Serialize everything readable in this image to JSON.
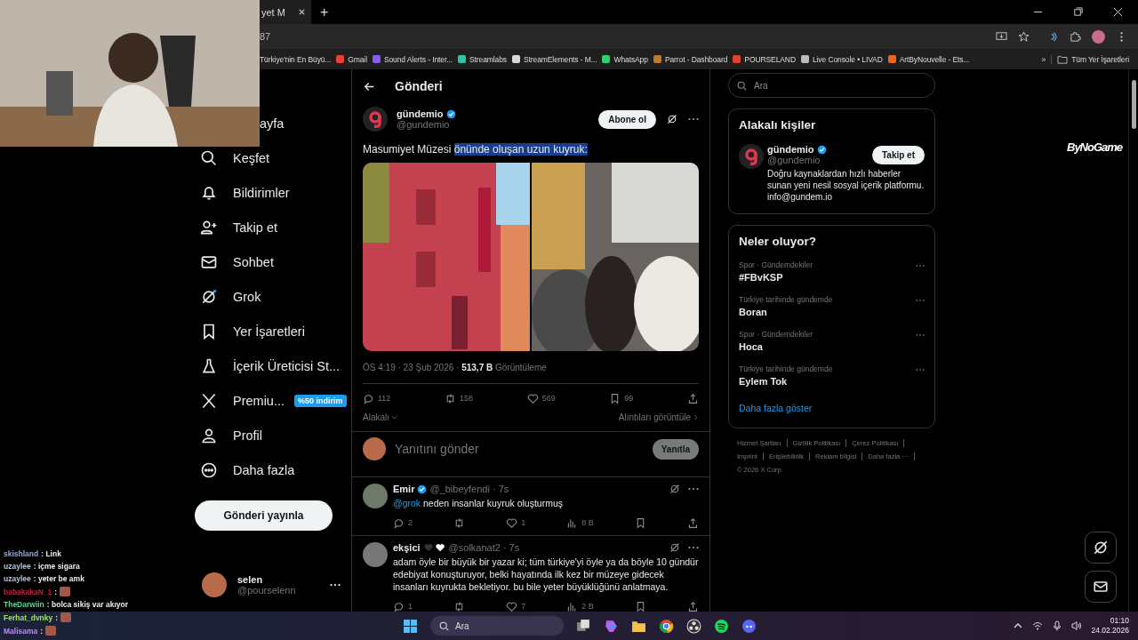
{
  "browser": {
    "tab_title": "yet M",
    "new_tab": "+",
    "address": "87",
    "bookmarks": [
      {
        "label": "Türkiye'nin En Büyü..."
      },
      {
        "label": "Gmail",
        "color": "#ea4335"
      },
      {
        "label": "Sound Alerts - Inter...",
        "color": "#8a5cf6"
      },
      {
        "label": "Streamlabs",
        "color": "#31c3a2"
      },
      {
        "label": "StreamElements - M...",
        "color": "#d9d9d9"
      },
      {
        "label": "WhatsApp",
        "color": "#25d366"
      },
      {
        "label": "Parrot - Dashboard",
        "color": "#c07a30"
      },
      {
        "label": "POURSELAND",
        "color": "#e0442a"
      },
      {
        "label": "Live Console • LIVAD",
        "color": "#bbbbbb"
      },
      {
        "label": "ArtByNouvelle - Ets...",
        "color": "#f1641e"
      }
    ],
    "more_bookmarks": "»",
    "all_bookmarks": "Tüm Yer İşaretleri"
  },
  "nav": {
    "items": [
      {
        "kind": "home",
        "label": "ayfa"
      },
      {
        "kind": "explore",
        "label": "Keşfet"
      },
      {
        "kind": "notifications",
        "label": "Bildirimler"
      },
      {
        "kind": "follow",
        "label": "Takip et"
      },
      {
        "kind": "chat",
        "label": "Sohbet"
      },
      {
        "kind": "grok",
        "label": "Grok"
      },
      {
        "kind": "bookmarks",
        "label": "Yer İşaretleri"
      },
      {
        "kind": "creator",
        "label": "İçerik Üreticisi St..."
      },
      {
        "kind": "premium",
        "label": "Premiu...",
        "badge": "%50 indirim"
      },
      {
        "kind": "profile",
        "label": "Profil"
      },
      {
        "kind": "more",
        "label": "Daha fazla"
      }
    ],
    "post_button": "Gönderi yayınla",
    "account": {
      "name": "selen",
      "handle": "@pourselenn"
    }
  },
  "post": {
    "header": "Gönderi",
    "author": {
      "name": "gündemio",
      "verified": true,
      "handle": "@gundemio"
    },
    "subscribe": "Abone ol",
    "text": "Masumiyet Müzesi ",
    "highlighted_text": "önünde oluşan uzun kuyruk:",
    "time": "ÖS 4:19 · 23 Şub 2026 · ",
    "views": "513,7 B",
    "views_label": "Görüntüleme",
    "actions": [
      {
        "kind": "reply",
        "count": "112"
      },
      {
        "kind": "repost",
        "count": "158"
      },
      {
        "kind": "like",
        "count": "569"
      },
      {
        "kind": "bookmark",
        "count": "99"
      },
      {
        "kind": "share"
      }
    ],
    "sort": "Alakalı",
    "quotes": "Alıntıları görüntüle"
  },
  "reply_box": {
    "placeholder": "Yanıtını gönder",
    "button": "Yanıtla"
  },
  "replies": [
    {
      "name": "Emir",
      "verified": true,
      "hearts": false,
      "handle": "@_bibeyfendi · 7s",
      "mention": "@grok",
      "text": " neden insanlar kuyruk oluşturmuş",
      "actions": [
        {
          "kind": "reply",
          "count": "2"
        },
        {
          "kind": "repost"
        },
        {
          "kind": "like",
          "count": "1"
        },
        {
          "kind": "views",
          "count": "8 B"
        },
        {
          "kind": "bookmark"
        },
        {
          "kind": "share"
        }
      ]
    },
    {
      "name": "ekşici",
      "verified": false,
      "hearts": true,
      "handle": "@solkanat2 · 7s",
      "text": "adam öyle bir büyük bir yazar ki; tüm türkiye'yi öyle ya da böyle 10 gündür edebiyat konuşturuyor, belki hayatında ilk kez bir müzeye gidecek insanları kuyrukta bekletiyor. bu bile yeter büyüklüğünü anlatmaya.",
      "actions": [
        {
          "kind": "reply",
          "count": "1"
        },
        {
          "kind": "repost"
        },
        {
          "kind": "like",
          "count": "7"
        },
        {
          "kind": "views",
          "count": "2 B"
        },
        {
          "kind": "bookmark"
        },
        {
          "kind": "share"
        }
      ]
    }
  ],
  "search": {
    "placeholder": "Ara"
  },
  "related": {
    "title": "Alakalı kişiler",
    "name": "gündemio",
    "verified": true,
    "handle": "@gundemio",
    "follow": "Takip et",
    "bio": "Doğru kaynaklardan hızlı haberler sunan yeni nesil sosyal içerik platformu. info@gundem.io"
  },
  "trends": {
    "title": "Neler oluyor?",
    "items": [
      {
        "context": "Spor · Gündemdekiler",
        "name": "#FBvKSP"
      },
      {
        "context": "Türkiye tarihinde gündemde",
        "name": "Boran"
      },
      {
        "context": "Spor · Gündemdekiler",
        "name": "Hoca"
      },
      {
        "context": "Türkiye tarihinde gündemde",
        "name": "Eylem Tok"
      }
    ],
    "more": "Daha fazla göster"
  },
  "footer": {
    "links": [
      "Hizmet Şartları",
      "Gizlilik Politikası",
      "Çerez Politikası",
      "Imprint",
      "Erişilebilirlik",
      "Reklam bilgisi",
      "Daha fazla ···"
    ],
    "copyright": "© 2026 X Corp."
  },
  "overlay_logo": "ByNoGame",
  "chat": [
    {
      "user": "skishland",
      "color": "#8fa8e8",
      "text": ": Link",
      "emote": false
    },
    {
      "user": "uzaylee",
      "color": "#b8c4dc",
      "text": ": içme sigara",
      "emote": false
    },
    {
      "user": "uzaylee",
      "color": "#b8c4dc",
      "text": ": yeter be amk",
      "emote": false
    },
    {
      "user": "babakakaN_1",
      "color": "#c0203a",
      "text": ":",
      "emote": true
    },
    {
      "user": "TheDarwiin",
      "color": "#5fd39a",
      "text": ": bolca sikiş var akıyor",
      "emote": false
    },
    {
      "user": "Ferhat_dvnky",
      "color": "#9be85a",
      "text": ":",
      "emote": true
    },
    {
      "user": "Malisama",
      "color": "#b58cf0",
      "text": ":",
      "emote": true
    }
  ],
  "taskbar": {
    "search": {
      "placeholder": "Ara"
    },
    "time": "01:10",
    "date": "24.02.2026"
  }
}
